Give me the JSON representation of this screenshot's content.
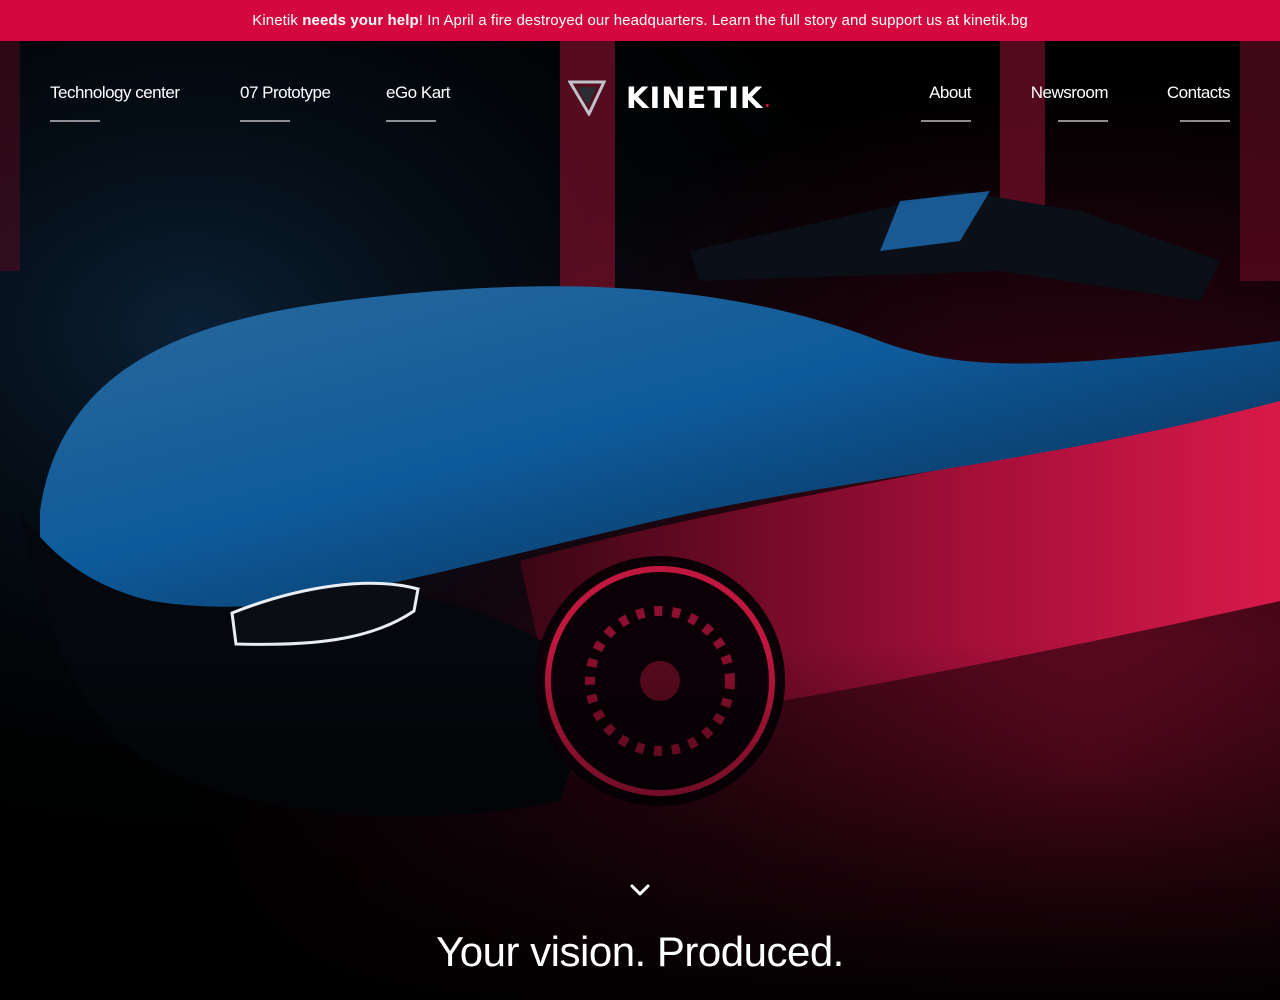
{
  "banner": {
    "brand": "Kinetik",
    "emphasis": "needs your help",
    "rest": "! In April a fire destroyed our headquarters. Learn the full story and support us at kinetik.bg"
  },
  "nav": {
    "left": [
      "Technology center",
      "07 Prototype",
      "eGo Kart"
    ],
    "right": [
      "About",
      "Newsroom",
      "Contacts"
    ]
  },
  "logo": {
    "text": "KINETIK",
    "dot": "."
  },
  "hero": {
    "tagline": "Your vision. Produced."
  },
  "icons": {
    "logo": "triangle-logo-icon",
    "scroll": "chevron-down-icon"
  },
  "colors": {
    "accent": "#d4083f",
    "background": "#000000",
    "text": "#ffffff"
  }
}
